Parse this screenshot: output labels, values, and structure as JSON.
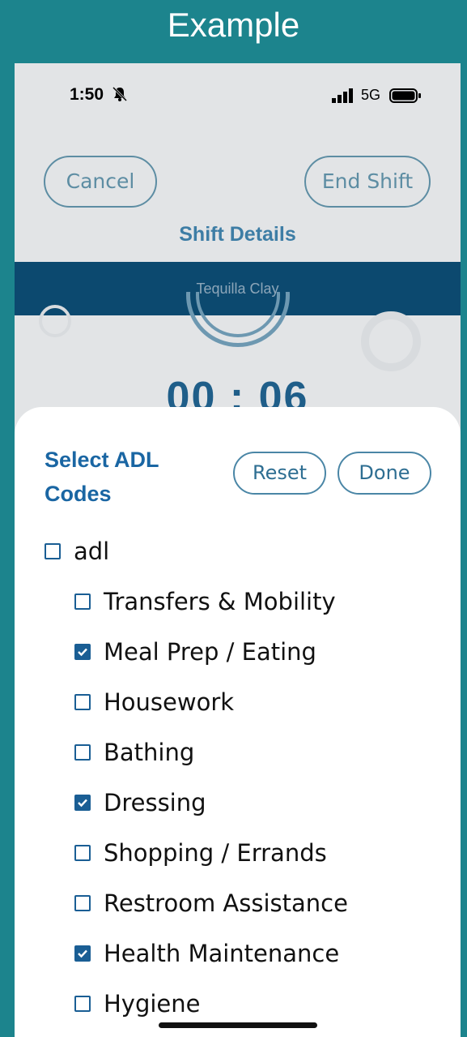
{
  "frame": {
    "title": "Example"
  },
  "status_bar": {
    "time": "1:50",
    "network": "5G"
  },
  "background_screen": {
    "cancel_label": "Cancel",
    "end_shift_label": "End Shift",
    "title": "Shift Details",
    "client_name": "Tequilla Clay",
    "timer": "00 : 06"
  },
  "sheet": {
    "title": "Select ADL Codes",
    "reset_label": "Reset",
    "done_label": "Done",
    "parent": {
      "label": "adl",
      "checked": false
    },
    "items": [
      {
        "label": "Transfers & Mobility",
        "checked": false
      },
      {
        "label": "Meal Prep / Eating",
        "checked": true
      },
      {
        "label": "Housework",
        "checked": false
      },
      {
        "label": "Bathing",
        "checked": false
      },
      {
        "label": "Dressing",
        "checked": true
      },
      {
        "label": "Shopping / Errands",
        "checked": false
      },
      {
        "label": "Restroom Assistance",
        "checked": false
      },
      {
        "label": "Health Maintenance",
        "checked": true
      },
      {
        "label": "Hygiene",
        "checked": false
      }
    ]
  },
  "colors": {
    "frame_bg": "#1c848d",
    "accent": "#1a5e94",
    "client_bar": "#0c4a71"
  }
}
